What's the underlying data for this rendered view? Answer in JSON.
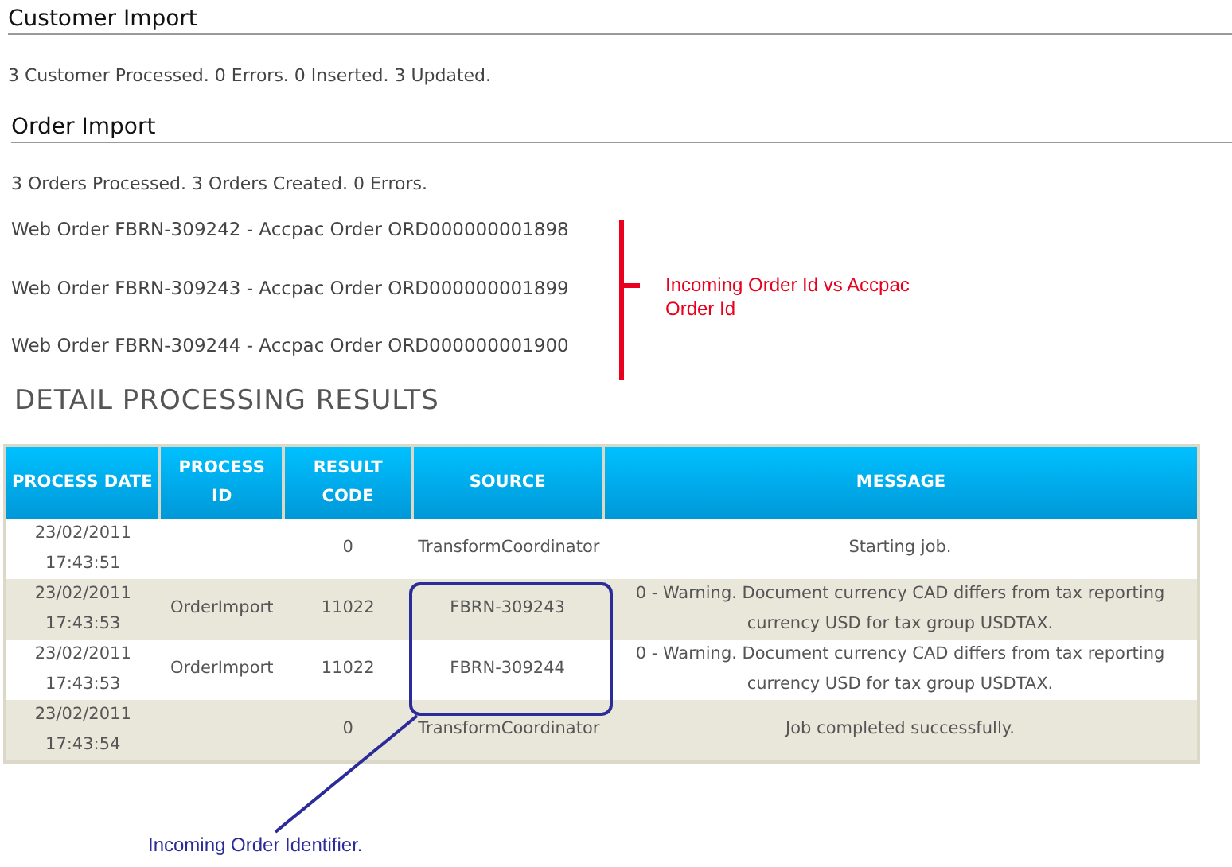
{
  "sections": [
    {
      "title": "Customer Import",
      "summary": "3 Customer Processed. 0 Errors. 0 Inserted. 3 Updated."
    },
    {
      "title": "Order Import",
      "summary": "3 Orders Processed. 3 Orders Created. 0 Errors.",
      "lines": [
        "Web Order FBRN-309242 - Accpac Order ORD000000001898",
        "Web Order FBRN-309243 - Accpac Order ORD000000001899",
        "Web Order FBRN-309244 - Accpac Order ORD000000001900"
      ]
    }
  ],
  "order_note": "Incoming Order Id vs Accpac Order Id",
  "detail": {
    "title": "DETAIL PROCESSING RESULTS",
    "columns": [
      "PROCESS DATE",
      "PROCESS ID",
      "RESULT CODE",
      "SOURCE",
      "MESSAGE"
    ],
    "rows": [
      {
        "date": "23/02/2011",
        "time": "17:43:51",
        "process_id": "",
        "result_code": "0",
        "source": "TransformCoordinator",
        "message": "Starting job."
      },
      {
        "date": "23/02/2011",
        "time": "17:43:53",
        "process_id": "OrderImport",
        "result_code": "11022",
        "source": "FBRN-309243",
        "message": "0 - Warning. Document currency CAD differs from tax reporting currency USD for tax group USDTAX."
      },
      {
        "date": "23/02/2011",
        "time": "17:43:53",
        "process_id": "OrderImport",
        "result_code": "11022",
        "source": "FBRN-309244",
        "message": "0 - Warning. Document currency CAD differs from tax reporting currency USD for tax group USDTAX."
      },
      {
        "date": "23/02/2011",
        "time": "17:43:54",
        "process_id": "",
        "result_code": "0",
        "source": "TransformCoordinator",
        "message": "Job completed successfully."
      }
    ]
  },
  "source_note": "Incoming Order Identifier."
}
